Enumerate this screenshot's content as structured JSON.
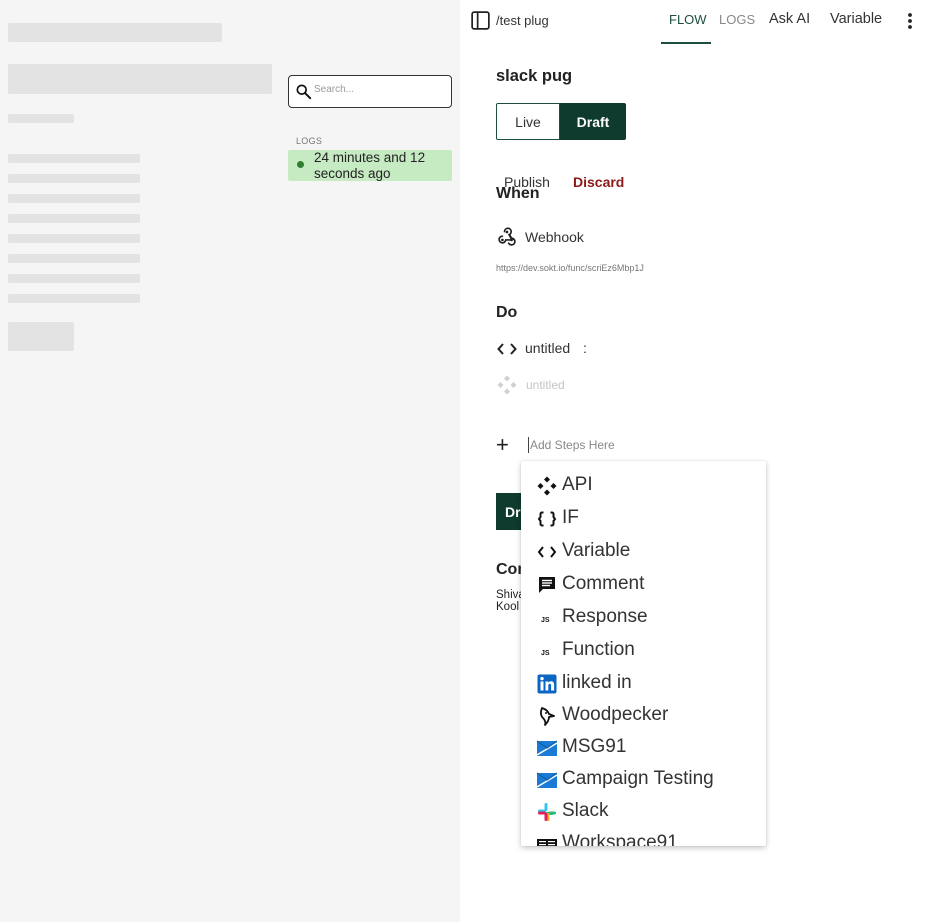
{
  "logs_panel": {
    "search_placeholder": "Search...",
    "heading": "LOGS",
    "items": [
      {
        "time": "24 minutes and 12 seconds ago",
        "status_color": "#2e7d32"
      }
    ]
  },
  "header": {
    "path": "/test plug",
    "tabs": [
      {
        "label": "FLOW",
        "active": true
      },
      {
        "label": "LOGS",
        "active": false
      }
    ],
    "ask_ai": "Ask AI",
    "variable": "Variable"
  },
  "flow": {
    "name": "slack pug",
    "live_label": "Live",
    "draft_label": "Draft",
    "publish_label": "Publish",
    "discard_label": "Discard",
    "when_title": "When",
    "trigger": {
      "label": "Webhook",
      "url": "https://dev.sokt.io/func/scriEz6Mbp1J"
    },
    "do_title": "Do",
    "steps": [
      {
        "label": "untitled",
        "suffix": ":",
        "icon": "code-brackets-icon"
      },
      {
        "label": "untitled",
        "icon": "api-diamond-icon",
        "disabled": true
      }
    ],
    "add_steps_placeholder": "Add Steps Here",
    "bg_button_fragment": "Dr",
    "bg_heading_fragment": "Con",
    "bg_text_fragment_1": "Shiva",
    "bg_text_fragment_2": "Kool"
  },
  "dropdown": {
    "items": [
      {
        "label": "API",
        "icon": "api-diamond-icon"
      },
      {
        "label": "IF",
        "icon": "curly-braces-icon"
      },
      {
        "label": "Variable",
        "icon": "code-brackets-icon"
      },
      {
        "label": "Comment",
        "icon": "comment-icon"
      },
      {
        "label": "Response",
        "icon": "js-icon"
      },
      {
        "label": "Function",
        "icon": "js-icon"
      },
      {
        "label": "linked in",
        "icon": "linkedin-icon"
      },
      {
        "label": "Woodpecker",
        "icon": "woodpecker-icon"
      },
      {
        "label": "MSG91",
        "icon": "msg91-icon"
      },
      {
        "label": "Campaign Testing",
        "icon": "msg91-icon"
      },
      {
        "label": "Slack",
        "icon": "slack-icon"
      },
      {
        "label": "Workspace91",
        "icon": "workspace91-icon"
      }
    ]
  },
  "colors": {
    "primary": "#0e3b2e",
    "discard": "#8b1a1a",
    "log_success_bg": "#c6eac2"
  }
}
